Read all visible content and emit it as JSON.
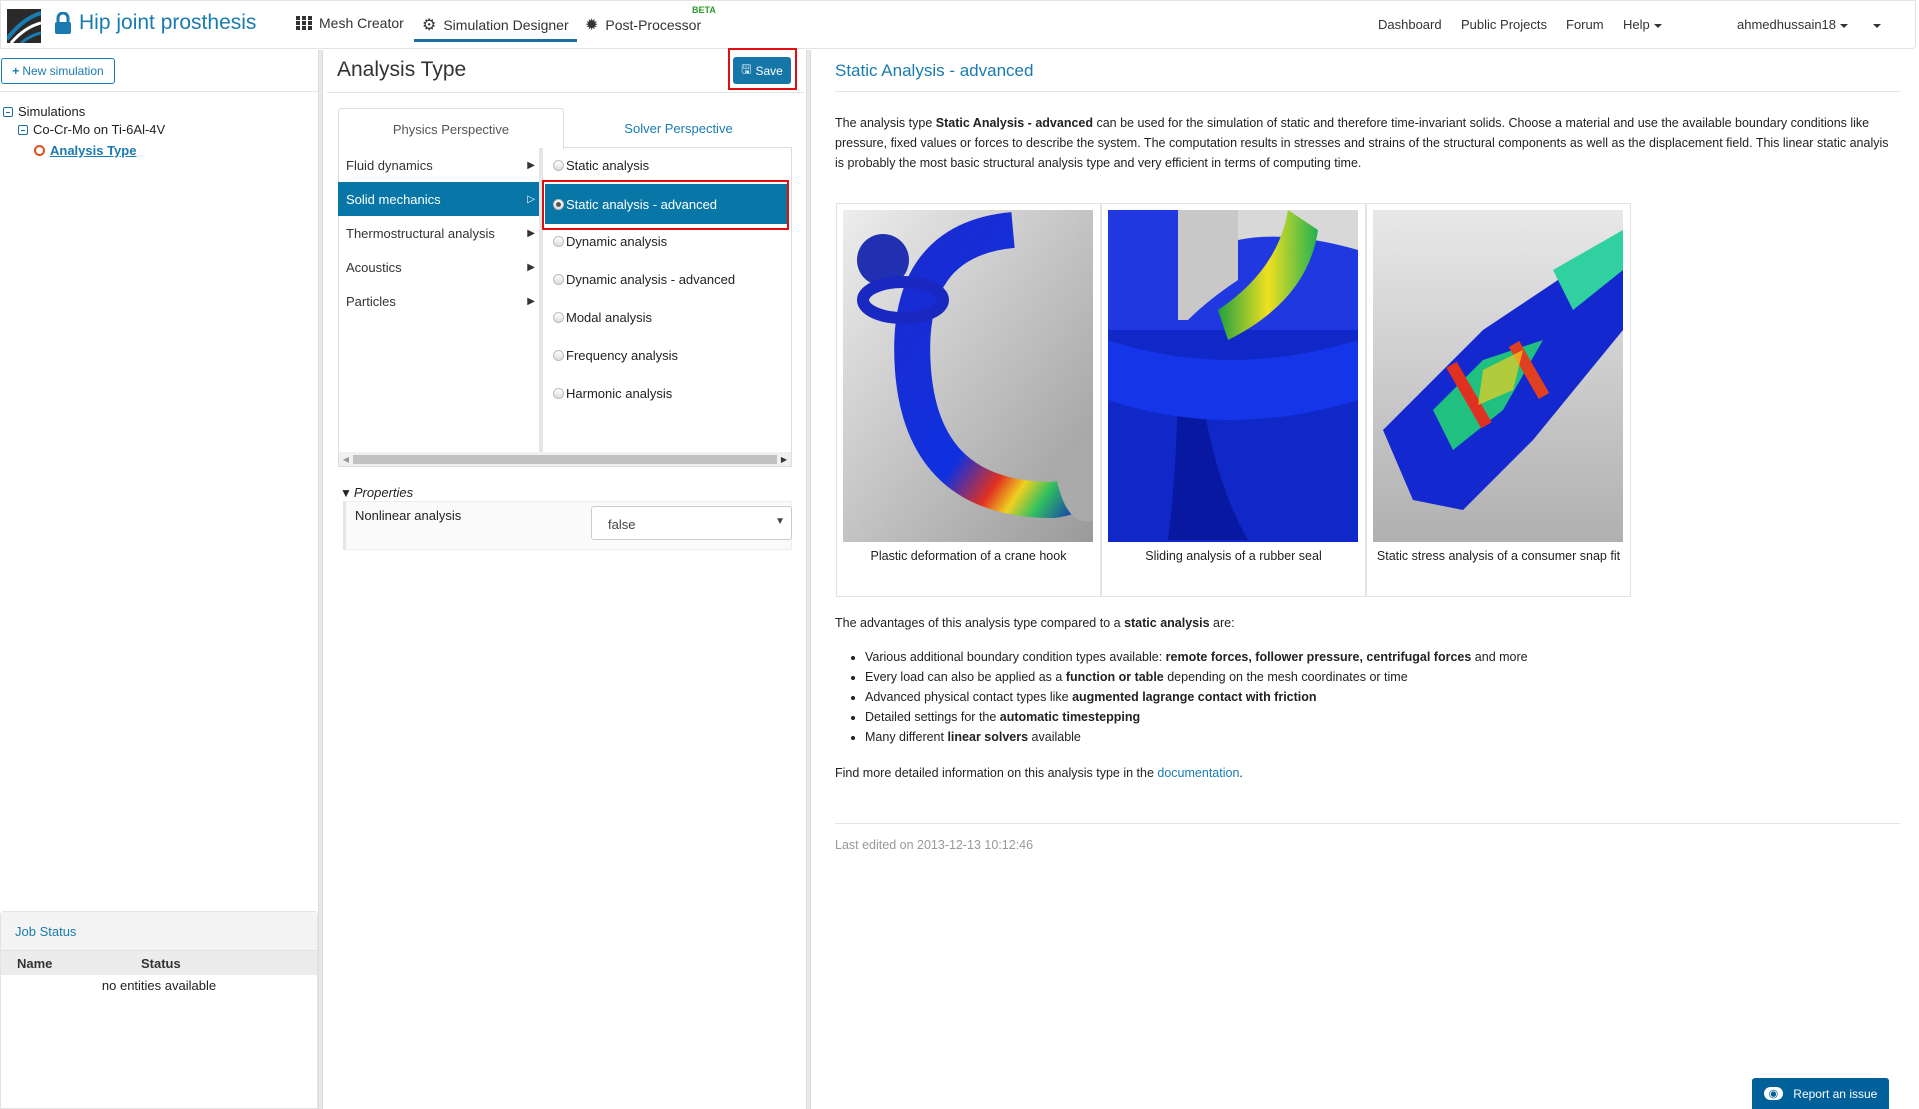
{
  "topbar": {
    "project_title": "Hip joint prosthesis",
    "nav": [
      {
        "label": "Mesh Creator",
        "icon": "grid-icon"
      },
      {
        "label": "Simulation Designer",
        "icon": "gears-icon",
        "active": true
      },
      {
        "label": "Post-Processor",
        "icon": "cog-icon"
      }
    ],
    "beta": "BETA",
    "right_nav": [
      "Dashboard",
      "Public Projects",
      "Forum",
      "Help"
    ],
    "user": "ahmedhussain18"
  },
  "left": {
    "new_simulation": "New simulation",
    "tree": {
      "root": "Simulations",
      "simulation": "Co-Cr-Mo on Ti-6Al-4V",
      "selected": "Analysis Type"
    },
    "job_status": {
      "title": "Job Status",
      "columns": [
        "Name",
        "Status"
      ],
      "empty": "no entities available"
    }
  },
  "middle": {
    "title": "Analysis Type",
    "save": "Save",
    "tabs": [
      "Physics Perspective",
      "Solver Perspective"
    ],
    "categories": [
      "Fluid dynamics",
      "Solid mechanics",
      "Thermostructural analysis",
      "Acoustics",
      "Particles"
    ],
    "selected_category": "Solid mechanics",
    "options": [
      "Static analysis",
      "Static analysis - advanced",
      "Dynamic analysis",
      "Dynamic analysis - advanced",
      "Modal analysis",
      "Frequency analysis",
      "Harmonic analysis"
    ],
    "selected_option": "Static analysis - advanced",
    "properties": {
      "title": "Properties",
      "label": "Nonlinear analysis",
      "value": "false"
    }
  },
  "right": {
    "title": "Static Analysis - advanced",
    "intro": {
      "pre": "The analysis type ",
      "bold": "Static Analysis - advanced",
      "post": " can be used for the simulation of static and therefore time-invariant solids. Choose a material and use the available boundary conditions like pressure, fixed values or forces to describe the system. The computation results in stresses and strains of the structural components as well as the displacement field. This linear static analyis is probably the most basic structural analysis type and very efficient in terms of computing time."
    },
    "images": [
      "Plastic deformation of a crane hook",
      "Sliding analysis of a rubber seal",
      "Static stress analysis of a consumer snap fit"
    ],
    "adv_intro": {
      "pre": "The advantages of this analysis type compared to a ",
      "bold": "static analysis",
      "post": " are:"
    },
    "advantages": [
      {
        "pre": "Various additional boundary condition types available: ",
        "bold": "remote forces, follower pressure, centrifugal forces",
        "post": " and more"
      },
      {
        "pre": "Every load can also be applied as a ",
        "bold": "function or table",
        "post": " depending on the mesh coordinates or time"
      },
      {
        "pre": "Advanced physical contact types like ",
        "bold": "augmented lagrange contact with friction",
        "post": ""
      },
      {
        "pre": "Detailed settings for the ",
        "bold": "automatic timestepping",
        "post": ""
      },
      {
        "pre": "Many different ",
        "bold": "linear solvers",
        "post": " available"
      }
    ],
    "more": {
      "pre": "Find more detailed information on this analysis type in the ",
      "link": "documentation",
      "post": "."
    },
    "last_edited": "Last edited on 2013-12-13 10:12:46"
  },
  "report": "Report an issue"
}
